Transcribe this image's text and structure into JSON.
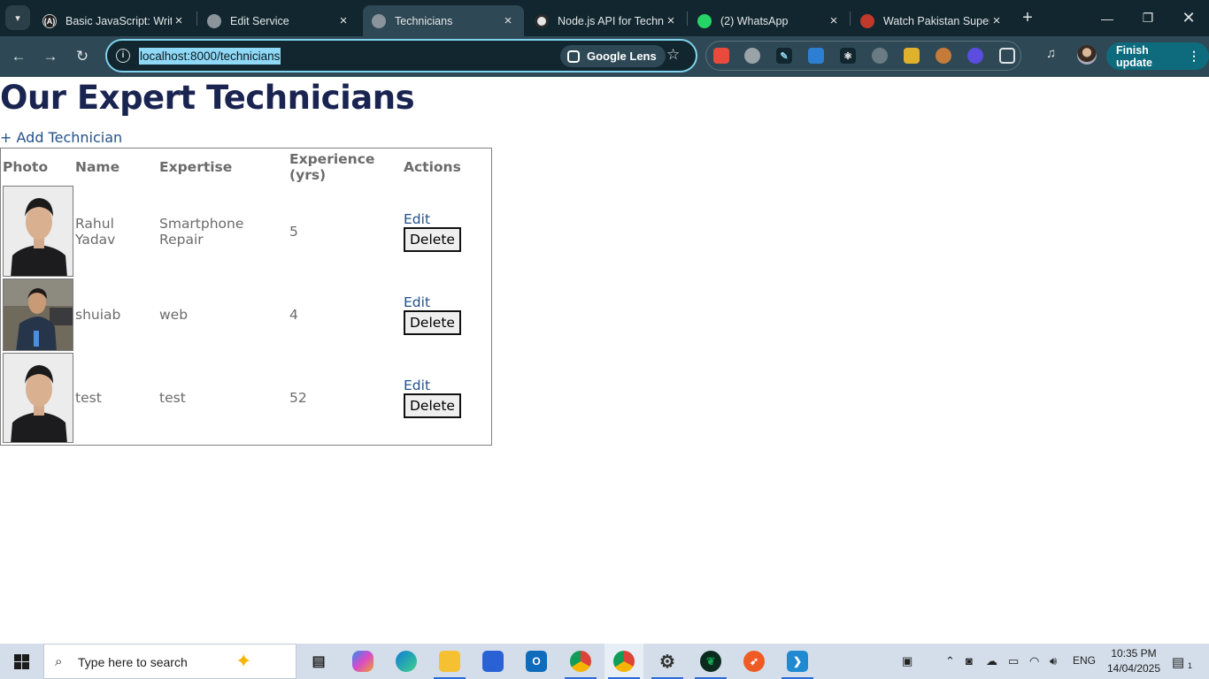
{
  "browser": {
    "tabs": [
      {
        "title": "Basic JavaScript: Write",
        "favicon_text": "(A)",
        "favicon_color": "#1f1f1f"
      },
      {
        "title": "Edit Service",
        "favicon_text": "",
        "favicon_color": "#8a949a"
      },
      {
        "title": "Technicians",
        "favicon_text": "",
        "favicon_color": "#8a949a"
      },
      {
        "title": "Node.js API for Techn",
        "favicon_text": "",
        "favicon_color": "#e6e6e6"
      },
      {
        "title": "(2) WhatsApp",
        "favicon_text": "",
        "favicon_color": "#25d366"
      },
      {
        "title": "Watch Pakistan Super",
        "favicon_text": "",
        "favicon_color": "#c0392b"
      }
    ],
    "active_tab": "Technicians",
    "address": "localhost:8000/technicians",
    "lens_label": "Google Lens",
    "finish_update_label": "Finish update"
  },
  "page": {
    "heading": "Our Expert Technicians",
    "add_link": "+ Add Technician",
    "table": {
      "headers": [
        "Photo",
        "Name",
        "Expertise",
        "Experience (yrs)",
        "Actions"
      ],
      "rows": [
        {
          "name": "Rahul Yadav",
          "expertise": "Smartphone Repair",
          "experience": "5",
          "edit": "Edit",
          "delete": "Delete"
        },
        {
          "name": "shuiab",
          "expertise": "web",
          "experience": "4",
          "edit": "Edit",
          "delete": "Delete"
        },
        {
          "name": "test",
          "expertise": "test",
          "experience": "52",
          "edit": "Edit",
          "delete": "Delete"
        }
      ]
    }
  },
  "taskbar": {
    "search_placeholder": "Type here to search",
    "language": "ENG",
    "time": "10:35 PM",
    "date": "14/04/2025",
    "notification_count": "1",
    "apps": [
      "task-view",
      "copilot",
      "edge",
      "file-explorer",
      "microsoft-store",
      "outlook",
      "chrome-profile",
      "chrome",
      "settings",
      "mongodb-compass",
      "postman",
      "vscode"
    ]
  },
  "colors": {
    "heading": "#1a2450",
    "link": "#22508a",
    "tabbar": "#11262f",
    "toolbar": "#2e4955",
    "finish_update": "#0e6b7e"
  }
}
